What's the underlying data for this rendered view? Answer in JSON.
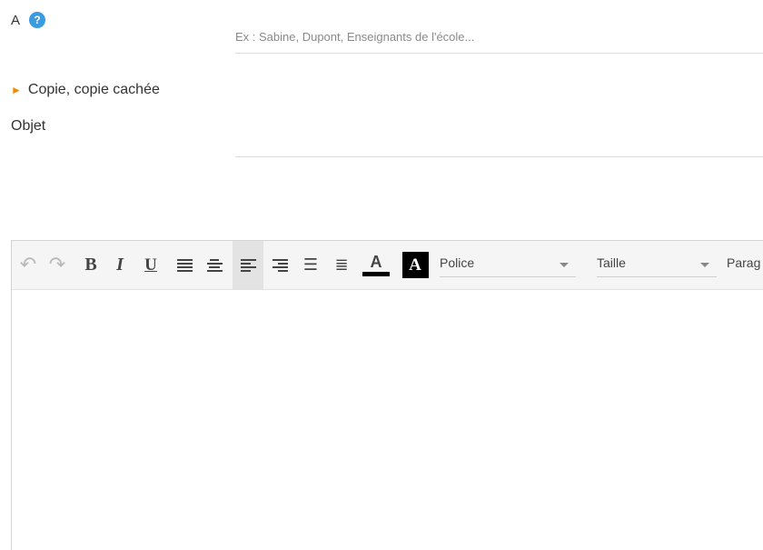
{
  "to": {
    "label": "A",
    "help": "?",
    "placeholder": "Ex : Sabine, Dupont, Enseignants de l'école..."
  },
  "cc": {
    "label": "Copie, copie cachée",
    "arrow": "►"
  },
  "subject": {
    "label": "Objet",
    "value": ""
  },
  "toolbar": {
    "font_label": "Police",
    "size_label": "Taille",
    "paragraph_label": "Parag",
    "undo": "↶",
    "redo": "↷",
    "bold": "B",
    "italic": "I",
    "underline": "U",
    "text_color": "A",
    "bg_color": "A",
    "accent_colors": {
      "help": "#3a9be0",
      "cc_arrow": "#f08c00"
    }
  }
}
